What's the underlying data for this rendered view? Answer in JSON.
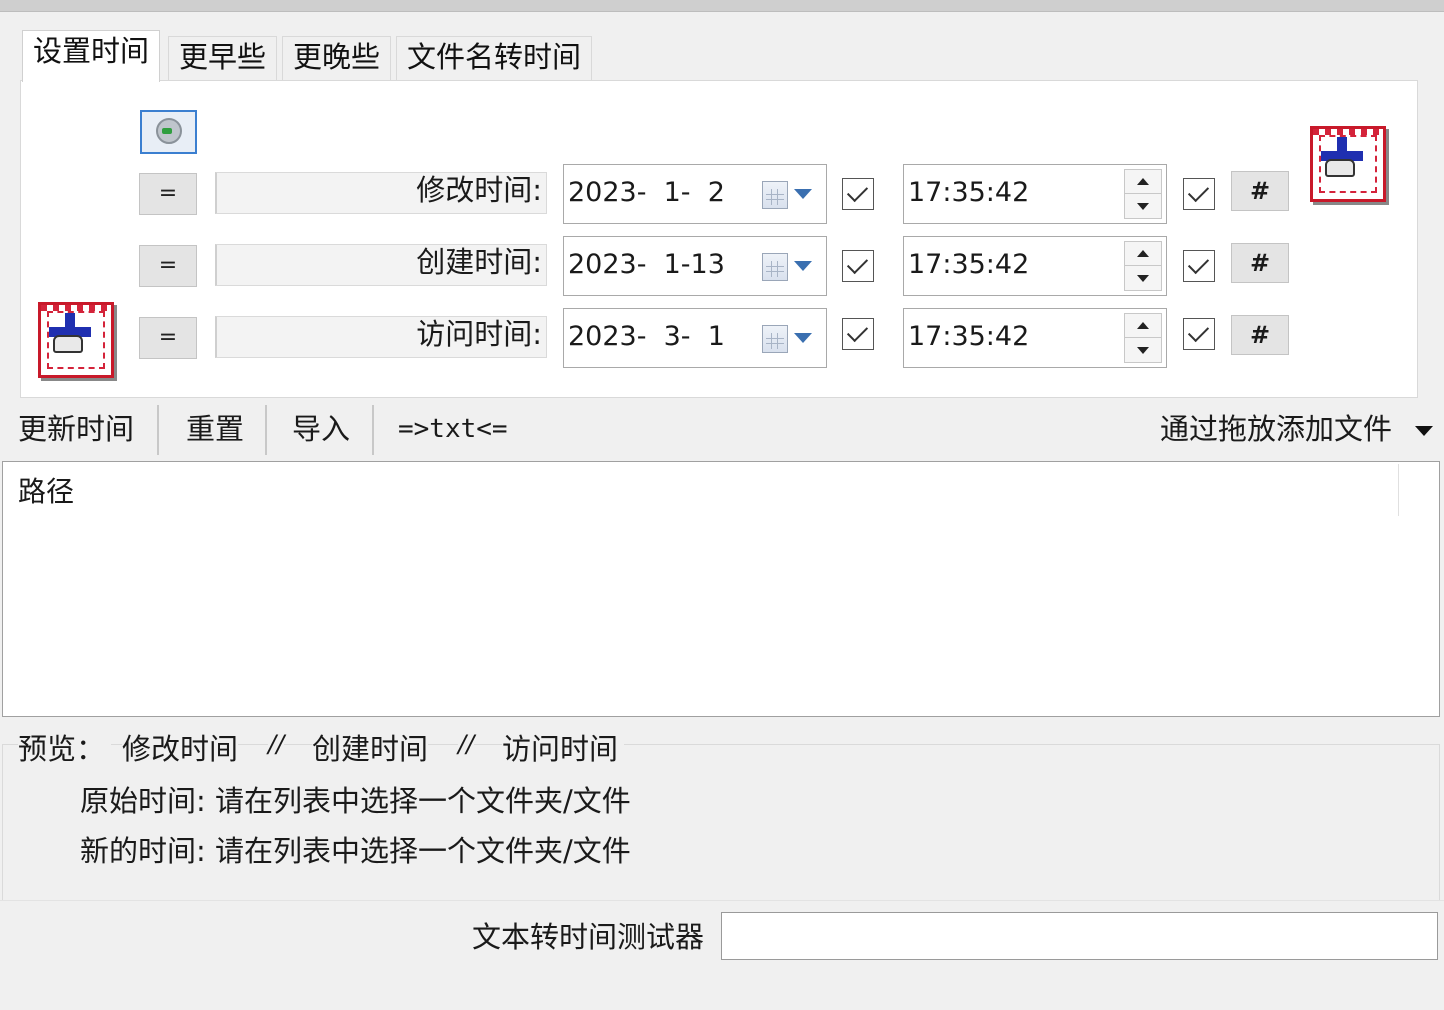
{
  "tabs": [
    "设置时间",
    "更早些",
    "更晚些",
    "文件名转时间"
  ],
  "rows": [
    {
      "label": "修改时间:",
      "date": "2023-  1-  2",
      "time": "17:35:42",
      "eq": "=",
      "hash": "#"
    },
    {
      "label": "创建时间:",
      "date": "2023-  1-13",
      "time": "17:35:42",
      "eq": "=",
      "hash": "#"
    },
    {
      "label": "访问时间:",
      "date": "2023-  3-  1",
      "time": "17:35:42",
      "eq": "=",
      "hash": "#"
    }
  ],
  "toolbar": {
    "update": "更新时间",
    "reset": "重置",
    "import": "导入",
    "txt": "=>txt<=",
    "drag_add": "通过拖放添加文件"
  },
  "list": {
    "header": "路径"
  },
  "preview": {
    "title": "预览：",
    "col1": "修改时间",
    "sep": "//",
    "col2": "创建时间",
    "col3": "访问时间",
    "original_label": "原始时间:",
    "original_value": "请在列表中选择一个文件夹/文件",
    "new_label": "新的时间:",
    "new_value": "请在列表中选择一个文件夹/文件"
  },
  "tester": {
    "label": "文本转时间测试器",
    "value": ""
  }
}
